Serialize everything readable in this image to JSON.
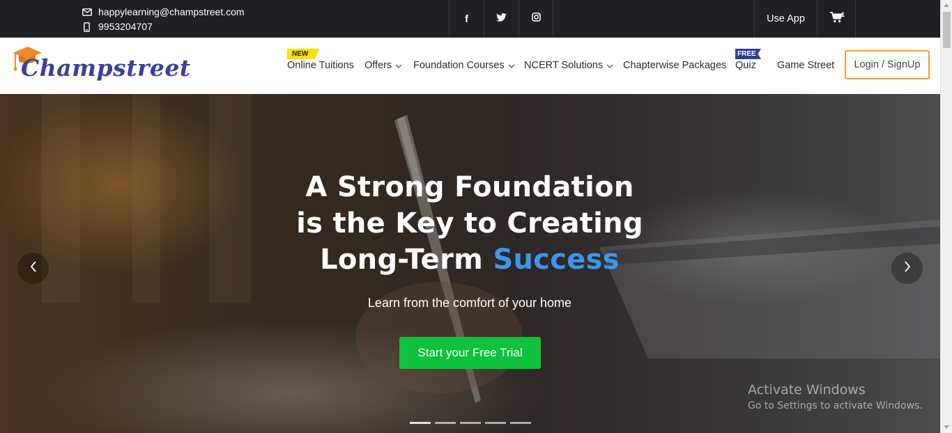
{
  "topbar": {
    "email": "happylearning@champstreet.com",
    "phone": "9953204707",
    "social": [
      {
        "icon": "facebook-icon",
        "glyph": "f"
      },
      {
        "icon": "twitter-icon"
      },
      {
        "icon": "instagram-icon"
      }
    ],
    "use_app_label": "Use App",
    "cart_count": "1"
  },
  "navbar": {
    "logo_text": "Champstreet",
    "items": [
      {
        "label": "Online Tuitions",
        "badge": "NEW",
        "dropdown": false
      },
      {
        "label": "Offers",
        "dropdown": true
      },
      {
        "label": "Foundation Courses",
        "dropdown": true
      },
      {
        "label": "NCERT Solutions",
        "dropdown": true
      },
      {
        "label": "Chapterwise Packages",
        "dropdown": false
      },
      {
        "label": "Quiz",
        "badge": "FREE",
        "dropdown": false
      },
      {
        "label": "Game Street",
        "dropdown": false
      }
    ],
    "login_label": "Login / SignUp"
  },
  "hero": {
    "title_line1": "A Strong Foundation",
    "title_line2": "is the Key to Creating",
    "title_line3_prefix": "Long-Term",
    "title_line3_accent": "Success",
    "subtitle": "Learn from the comfort of your home",
    "cta_label": "Start your Free Trial",
    "slide_count": 5
  },
  "watermark": {
    "title": "Activate Windows",
    "subtitle": "Go to Settings to activate Windows."
  },
  "colors": {
    "topbar_bg": "#1f2023",
    "logo_blue": "#3b3f9e",
    "logo_cap": "#f08a24",
    "accent_blue": "#3c95ee",
    "cta_green": "#0fc13d",
    "login_border": "#f29a2e",
    "new_badge": "#ffde00",
    "free_badge": "#2d3e98"
  }
}
